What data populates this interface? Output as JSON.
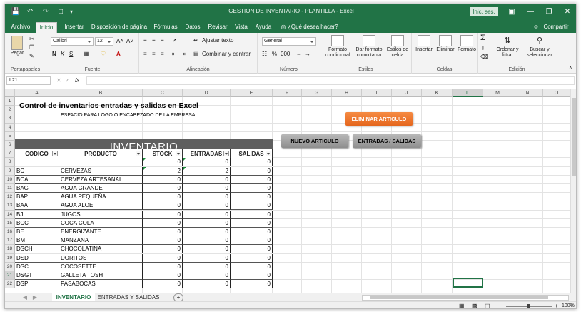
{
  "window": {
    "title": "GESTION DE INVENTARIO - PLANTILLA  -  Excel",
    "signin": "Inic. ses."
  },
  "ribbon_tabs": [
    "Archivo",
    "Inicio",
    "Insertar",
    "Disposición de página",
    "Fórmulas",
    "Datos",
    "Revisar",
    "Vista",
    "Ayuda"
  ],
  "tell_me": "¿Qué desea hacer?",
  "share": "Compartir",
  "ribbon": {
    "paste": "Pegar",
    "clipboard": "Portapapeles",
    "font_name": "Calibri",
    "font_size": "12",
    "font_group": "Fuente",
    "wrap": "Ajustar texto",
    "merge": "Combinar y centrar",
    "align_group": "Alineación",
    "number_format": "General",
    "number_group": "Número",
    "cond_format": "Formato condicional",
    "format_table": "Dar formato como tabla",
    "cell_styles": "Estilos de celda",
    "styles_group": "Estilos",
    "insert": "Insertar",
    "delete": "Eliminar",
    "format": "Formato",
    "cells_group": "Celdas",
    "sort": "Ordenar y filtrar",
    "find": "Buscar y seleccionar",
    "edit_group": "Edición",
    "bold": "N",
    "italic": "K",
    "underline": "S",
    "percent": "%",
    "thousands": "000"
  },
  "namebox": "L21",
  "fx": "fx",
  "columns": [
    "A",
    "B",
    "C",
    "D",
    "E",
    "F",
    "G",
    "H",
    "I",
    "J",
    "K",
    "L",
    "M",
    "N",
    "O"
  ],
  "rows": [
    "1",
    "2",
    "3",
    "4",
    "5",
    "6",
    "7",
    "8",
    "9",
    "10",
    "11",
    "12",
    "13",
    "14",
    "15",
    "16",
    "17",
    "18",
    "19",
    "20",
    "21",
    "22"
  ],
  "sheet": {
    "title": "Control de inventarios entradas y salidas en Excel",
    "logo_text": "ESPACIO PARA LOGO O ENCABEZADO DE LA EMPRESA",
    "banner": "INVENTARIO",
    "headers": [
      "CODIGO",
      "PRODUCTO",
      "STOCK",
      "ENTRADAS",
      "SALIDAS"
    ],
    "btn_eliminar": "ELIMINAR ARTICULO",
    "btn_nuevo": "NUEVO ARTICULO",
    "btn_entradas": "ENTRADAS / SALIDAS",
    "table_rows": [
      [
        "",
        "",
        "0",
        "0",
        "0"
      ],
      [
        "BC",
        "CERVEZAS",
        "2",
        "2",
        "0"
      ],
      [
        "BCA",
        "CERVEZA  ARTESANAL",
        "0",
        "0",
        "0"
      ],
      [
        "BAG",
        "AGUA GRANDE",
        "0",
        "0",
        "0"
      ],
      [
        "BAP",
        "AGUA PEQUEÑA",
        "0",
        "0",
        "0"
      ],
      [
        "BAA",
        "AGUA ALOE",
        "0",
        "0",
        "0"
      ],
      [
        "BJ",
        "JUGOS",
        "0",
        "0",
        "0"
      ],
      [
        "BCC",
        "COCA COLA",
        "0",
        "0",
        "0"
      ],
      [
        "BE",
        "ENERGIZANTE",
        "0",
        "0",
        "0"
      ],
      [
        "BM",
        "MANZANA",
        "0",
        "0",
        "0"
      ],
      [
        "DSCH",
        "CHOCOLATINA",
        "0",
        "0",
        "0"
      ],
      [
        "DSD",
        "DORITOS",
        "0",
        "0",
        "0"
      ],
      [
        "DSC",
        "COCOSETTE",
        "0",
        "0",
        "0"
      ],
      [
        "DSGT",
        "GALLETA TOSH",
        "0",
        "0",
        "0"
      ],
      [
        "DSP",
        "PASABOCAS",
        "0",
        "0",
        "0"
      ]
    ]
  },
  "sheet_tabs": [
    "INVENTARIO",
    "ENTRADAS Y SALIDAS"
  ],
  "zoom": "100%",
  "colors": {
    "excel_green": "#217346",
    "banner": "#5f5f5f",
    "orange": "#ee7a30"
  }
}
